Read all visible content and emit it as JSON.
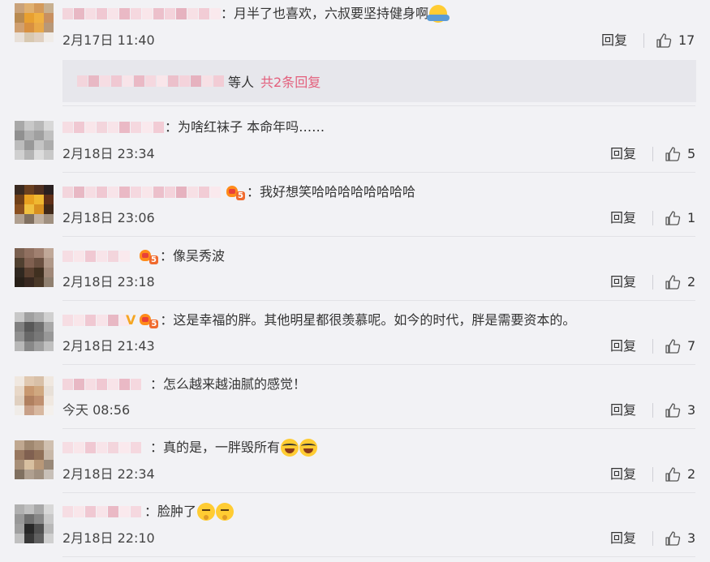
{
  "comments": [
    {
      "text": "：月半了也喜欢，六叔要坚持健身啊",
      "time": "2月17日 11:40",
      "reply": "回复",
      "likes": "17",
      "emojis": [
        "hug-emoji"
      ]
    },
    {
      "text": "：为啥红袜子 本命年吗……",
      "time": "2月18日 23:34",
      "reply": "回复",
      "likes": "5"
    },
    {
      "text": "：我好想笑哈哈哈哈哈哈哈哈",
      "time": "2月18日 23:06",
      "reply": "回复",
      "likes": "1",
      "badge": "5"
    },
    {
      "text": "：像吴秀波",
      "time": "2月18日 23:18",
      "reply": "回复",
      "likes": "2",
      "badge": "5"
    },
    {
      "text": "：这是幸福的胖。其他明星都很羡慕呢。如今的时代，胖是需要资本的。",
      "time": "2月18日 21:43",
      "reply": "回复",
      "likes": "7",
      "badge": "5",
      "verified": "V"
    },
    {
      "text": "：怎么越来越油腻的感觉！",
      "time": "今天 08:56",
      "reply": "回复",
      "likes": "3"
    },
    {
      "text": "：真的是，一胖毁所有",
      "time": "2月18日 22:34",
      "reply": "回复",
      "likes": "2",
      "emojis": [
        "laugh-cry-emoji",
        "laugh-cry-emoji"
      ]
    },
    {
      "text": "：脸肿了",
      "time": "2月18日 22:10",
      "reply": "回复",
      "likes": "3",
      "emojis": [
        "thinking-emoji",
        "thinking-emoji"
      ]
    }
  ],
  "sub_replies": {
    "suffix": "等人",
    "more_link": "共2条回复"
  },
  "colors": {
    "background": "#f2f2f5",
    "link_pink": "#e35f7c",
    "sub_box": "#e7e7ec"
  }
}
